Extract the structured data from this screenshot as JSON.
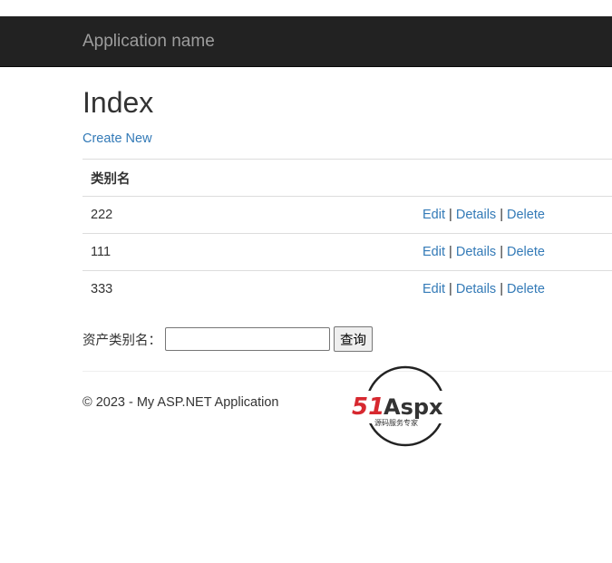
{
  "navbar": {
    "brand": "Application name"
  },
  "page": {
    "title": "Index",
    "create_new": "Create New"
  },
  "table": {
    "header": "类别名",
    "rows": [
      {
        "name": "222",
        "edit": "Edit",
        "details": "Details",
        "delete": "Delete"
      },
      {
        "name": "111",
        "edit": "Edit",
        "details": "Details",
        "delete": "Delete"
      },
      {
        "name": "333",
        "edit": "Edit",
        "details": "Details",
        "delete": "Delete"
      }
    ],
    "separator": "|"
  },
  "search": {
    "label": "资产类别名：",
    "value": "",
    "button": "查询"
  },
  "footer": {
    "text": "© 2023 - My ASP.NET Application"
  },
  "watermark": {
    "brand": "51Aspx",
    "tagline": "源码服务专家"
  },
  "colors": {
    "navbar": "#222222",
    "brand": "#9d9d9d",
    "link": "#337ab7",
    "logo_red": "#d7282f",
    "logo_green": "#3ea83a"
  }
}
